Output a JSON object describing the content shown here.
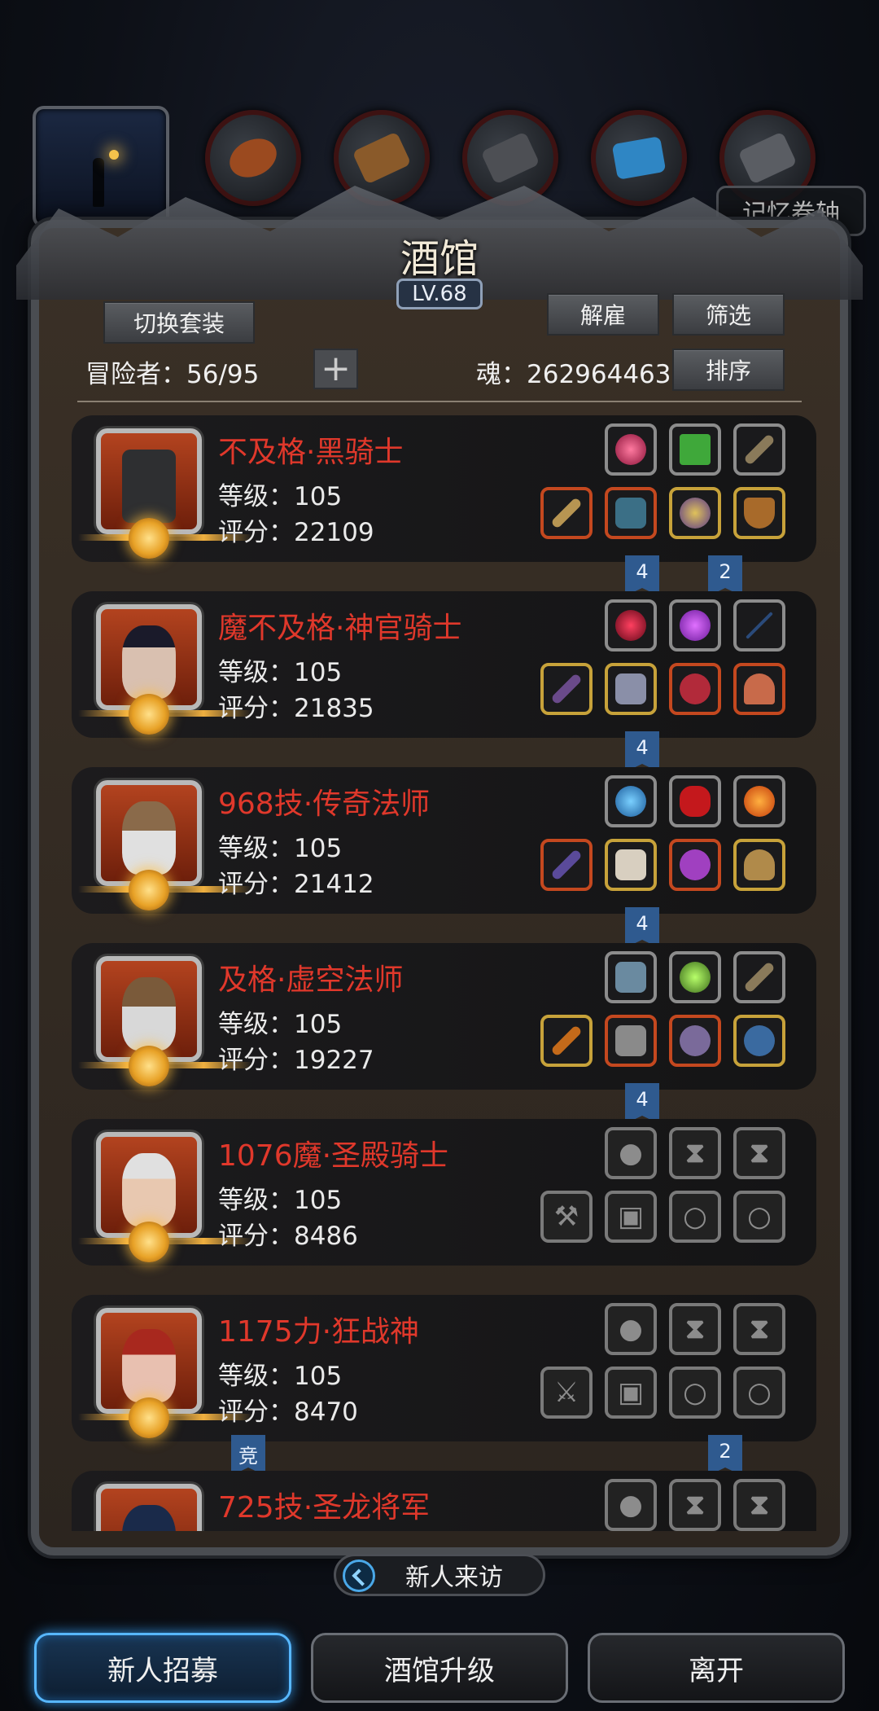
{
  "header": {
    "memory_scroll_label": "记忆卷轴",
    "title": "酒馆",
    "level": "LV.68"
  },
  "toolbar": {
    "switch_set_label": "切换套装",
    "dismiss_label": "解雇",
    "filter_label": "筛选",
    "sort_label": "排序",
    "adventurer_label": "冒险者：56/95",
    "plus_label": "+",
    "soul_label": "魂：262964463"
  },
  "adventurers": [
    {
      "name": "不及格·黑骑士",
      "level": "等级：105",
      "score": "评分：22109",
      "tags": [
        "4",
        "2"
      ]
    },
    {
      "name": "魔不及格·神官骑士",
      "level": "等级：105",
      "score": "评分：21835",
      "tags": [
        "4"
      ]
    },
    {
      "name": "968技·传奇法师",
      "level": "等级：105",
      "score": "评分：21412",
      "tags": [
        "4"
      ]
    },
    {
      "name": "及格·虚空法师",
      "level": "等级：105",
      "score": "评分：19227",
      "tags": [
        "4"
      ]
    },
    {
      "name": "1076魔·圣殿骑士",
      "level": "等级：105",
      "score": "评分：8486",
      "tags": []
    },
    {
      "name": "1175力·狂战神",
      "level": "等级：105",
      "score": "评分：8470",
      "tags": [
        "竞",
        "2"
      ]
    },
    {
      "name": "725技·圣龙将军",
      "level": "",
      "score": "",
      "tags": []
    }
  ],
  "footer": {
    "newcomer_label": "新人来访",
    "recruit_label": "新人招募",
    "upgrade_label": "酒馆升级",
    "leave_label": "离开"
  },
  "colors": {
    "name_red": "#e0382b",
    "tag_blue": "#2f5a8f",
    "active_blue": "#57b7ff"
  }
}
